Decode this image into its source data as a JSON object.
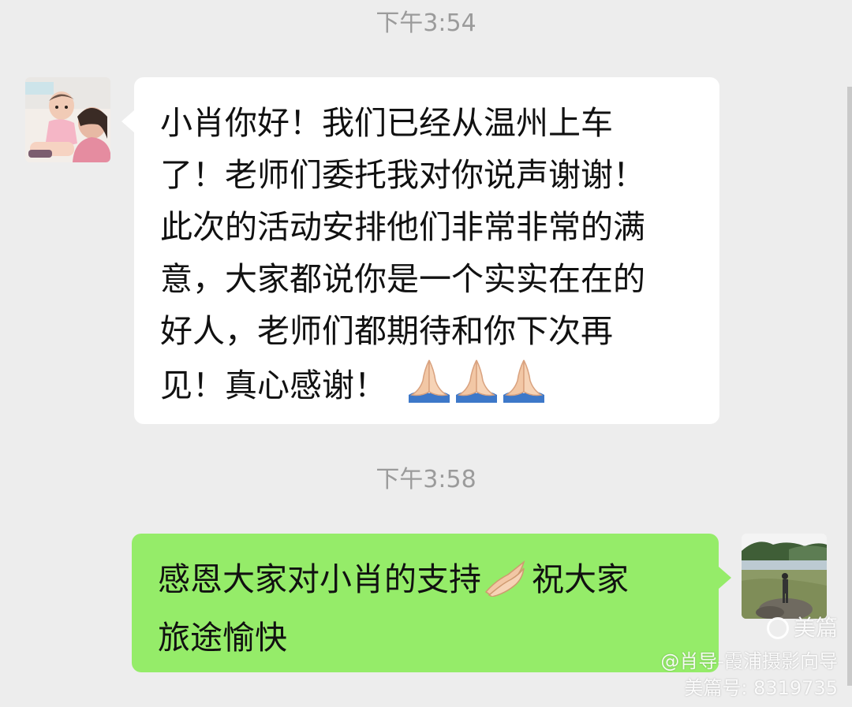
{
  "timestamps": [
    "下午3:54",
    "下午3:58"
  ],
  "messages": [
    {
      "side": "left",
      "avatar": "avatar-photo-woman-with-baby",
      "lines": [
        "小肖你好！我们已经从温州上车",
        "了！老师们委托我对你说声谢谢！",
        "此次的活动安排他们非常非常的满",
        "意，大家都说你是一个实实在在的",
        "好人，老师们都期待和你下次再",
        "见！真心感谢！"
      ],
      "trailing_emoji": "folded-hands-icon x3"
    },
    {
      "side": "right",
      "avatar": "avatar-photo-person-by-lake",
      "lines": [
        "感恩大家对小肖的支持",
        "祝大家",
        "旅途愉快"
      ],
      "inline_emoji": "folded-hands-icon"
    }
  ],
  "watermark": {
    "logo": "美篇",
    "author": "@肖导-霞浦摄影向导",
    "id": "美篇号: 8319735"
  },
  "colors": {
    "background": "#ededed",
    "incoming_bubble": "#ffffff",
    "outgoing_bubble": "#95ec69",
    "timestamp_text": "#9b9b9b"
  }
}
